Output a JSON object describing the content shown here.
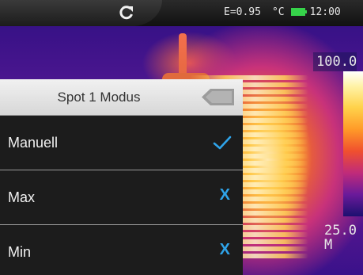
{
  "status": {
    "emissivity": "E=0.95",
    "unit": "°C",
    "time": "12:00"
  },
  "scale": {
    "max_label": "100.0",
    "min_label": "25.0",
    "mode_label": "M"
  },
  "menu": {
    "title": "Spot 1 Modus",
    "items": [
      {
        "label": "Manuell",
        "selected": true
      },
      {
        "label": "Max",
        "selected": false
      },
      {
        "label": "Min",
        "selected": false
      }
    ]
  },
  "colors": {
    "accent": "#2fa4ea",
    "battery": "#36d34a",
    "menu_bg": "#1c1c1c",
    "header_bg": "#e4e4e4"
  },
  "icons": {
    "refresh": "refresh-icon",
    "battery": "battery-icon",
    "back": "back-arrow-icon",
    "selected": "checkmark-icon",
    "unselected": "x-icon"
  }
}
